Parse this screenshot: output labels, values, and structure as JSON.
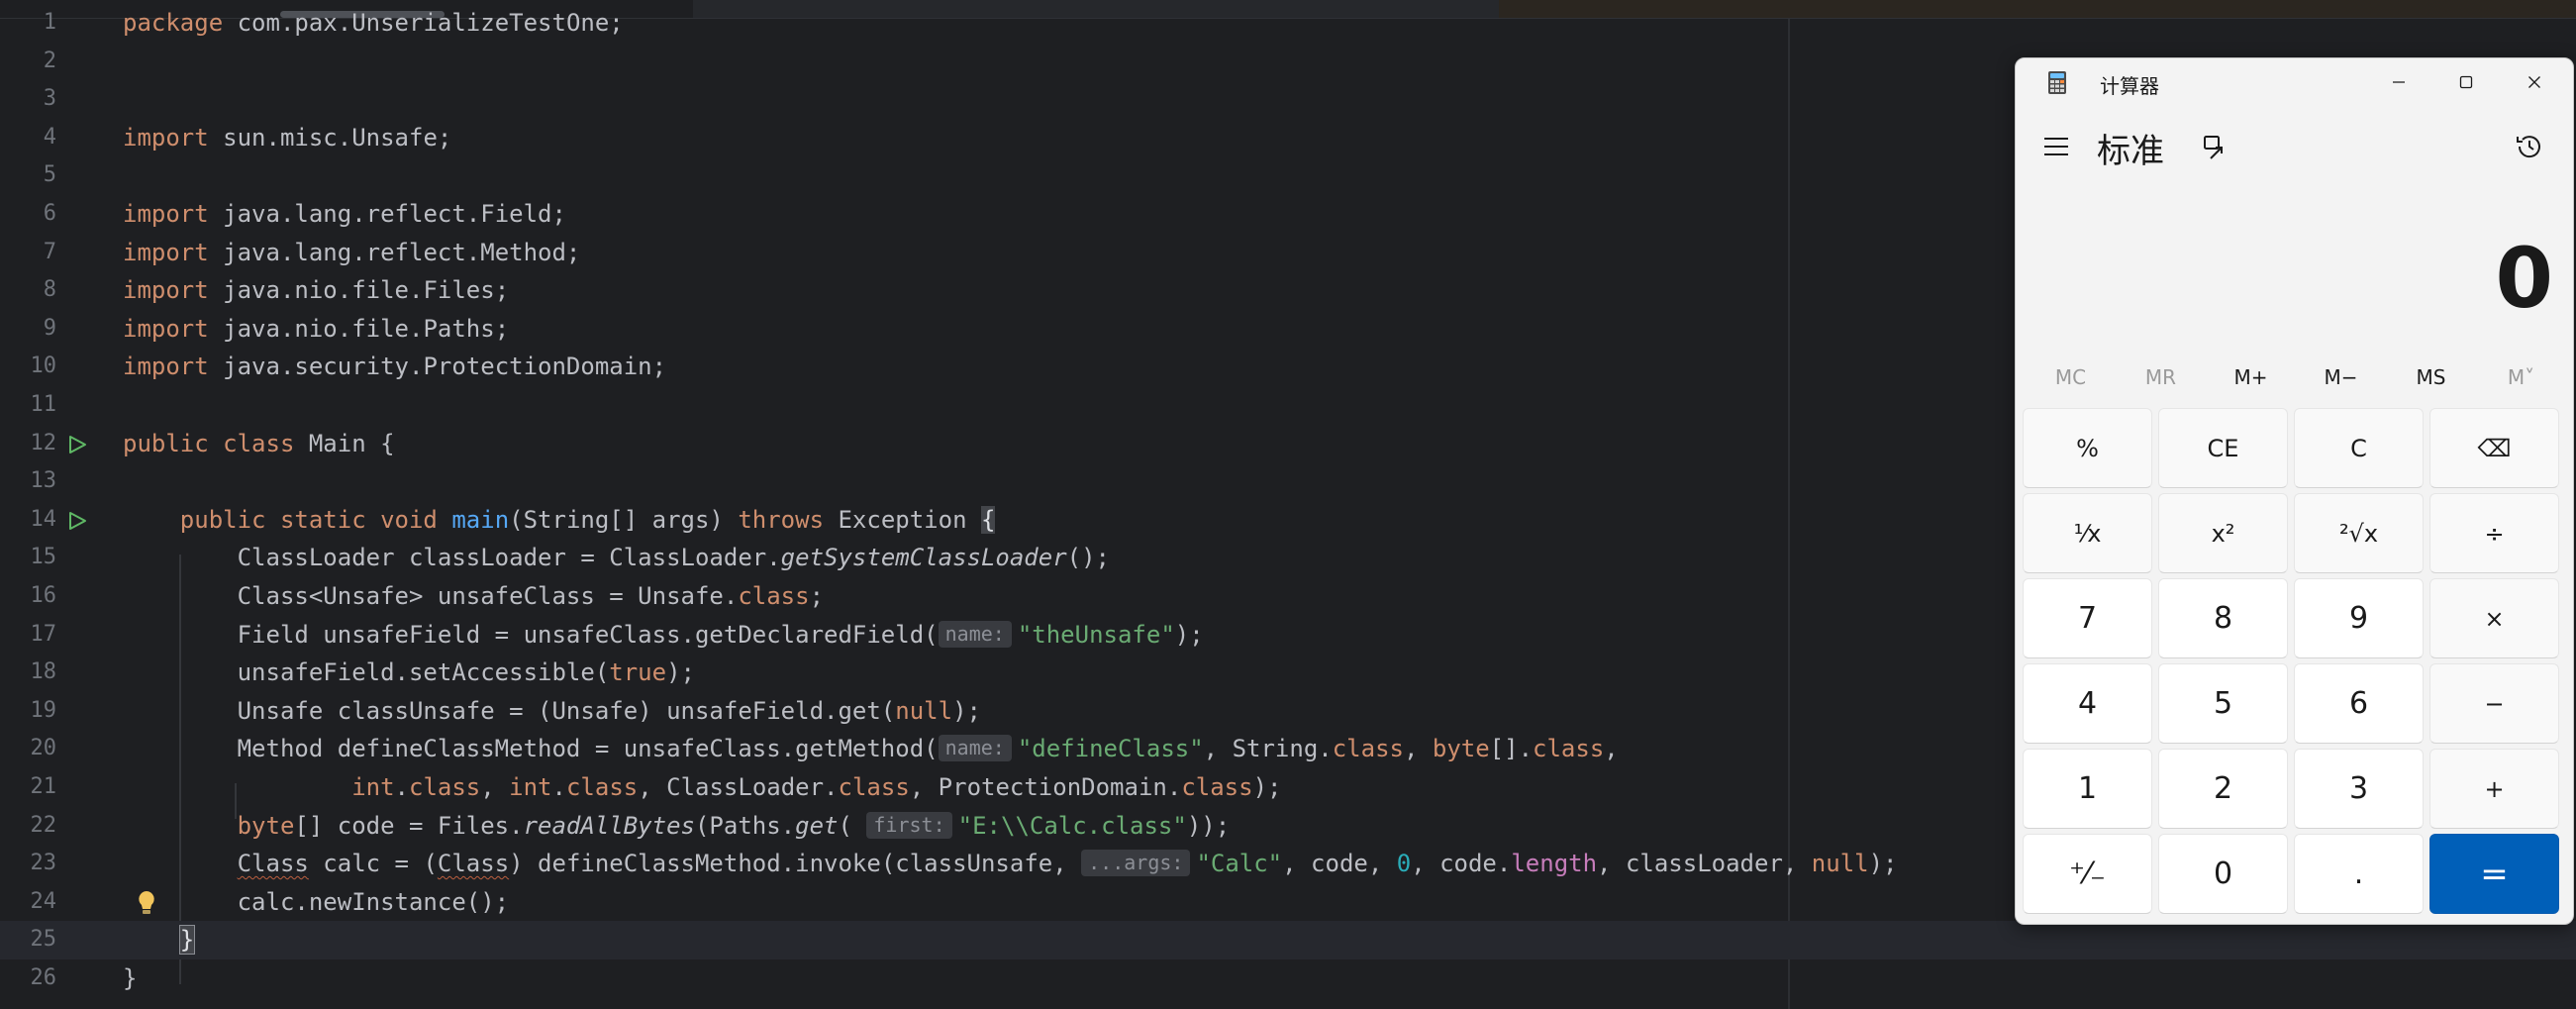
{
  "editor": {
    "current_line": 25,
    "param_hints": {
      "name": "name:",
      "first": "first:",
      "args": "...args:"
    },
    "lines": [
      {
        "n": "1",
        "parts": [
          [
            "kw",
            "package"
          ],
          [
            "t",
            " com.pax.UnserializeTestOne;"
          ]
        ]
      },
      {
        "n": "2",
        "parts": []
      },
      {
        "n": "3",
        "parts": []
      },
      {
        "n": "4",
        "parts": [
          [
            "kw",
            "import"
          ],
          [
            "t",
            " sun.misc.Unsafe;"
          ]
        ]
      },
      {
        "n": "5",
        "parts": []
      },
      {
        "n": "6",
        "parts": [
          [
            "kw",
            "import"
          ],
          [
            "t",
            " java.lang.reflect.Field;"
          ]
        ]
      },
      {
        "n": "7",
        "parts": [
          [
            "kw",
            "import"
          ],
          [
            "t",
            " java.lang.reflect.Method;"
          ]
        ]
      },
      {
        "n": "8",
        "parts": [
          [
            "kw",
            "import"
          ],
          [
            "t",
            " java.nio.file.Files;"
          ]
        ]
      },
      {
        "n": "9",
        "parts": [
          [
            "kw",
            "import"
          ],
          [
            "t",
            " java.nio.file.Paths;"
          ]
        ]
      },
      {
        "n": "10",
        "parts": [
          [
            "kw",
            "import"
          ],
          [
            "t",
            " java.security.ProtectionDomain;"
          ]
        ]
      },
      {
        "n": "11",
        "parts": []
      },
      {
        "n": "12",
        "run": true,
        "parts": [
          [
            "kw",
            "public class"
          ],
          [
            "t",
            " Main {"
          ]
        ]
      },
      {
        "n": "13",
        "parts": []
      },
      {
        "n": "14",
        "run": true,
        "parts": [
          [
            "t",
            "    "
          ],
          [
            "kw",
            "public static void"
          ],
          [
            "t",
            " "
          ],
          [
            "fn",
            "main"
          ],
          [
            "t",
            "(String[] args) "
          ],
          [
            "kw",
            "throws"
          ],
          [
            "t",
            " Exception "
          ],
          [
            "brace",
            "{"
          ]
        ]
      },
      {
        "n": "15",
        "parts": [
          [
            "t",
            "        ClassLoader classLoader = ClassLoader."
          ],
          [
            "it",
            "getSystemClassLoader"
          ],
          [
            "t",
            "();"
          ]
        ]
      },
      {
        "n": "16",
        "parts": [
          [
            "t",
            "        Class<Unsafe> unsafeClass = Unsafe."
          ],
          [
            "kw",
            "class"
          ],
          [
            "t",
            ";"
          ]
        ]
      },
      {
        "n": "17",
        "parts": [
          [
            "t",
            "        Field unsafeField = unsafeClass.getDeclaredField("
          ],
          [
            "hint",
            "name:"
          ],
          [
            "str",
            "\"theUnsafe\""
          ],
          [
            "t",
            ");"
          ]
        ]
      },
      {
        "n": "18",
        "parts": [
          [
            "t",
            "        unsafeField.setAccessible("
          ],
          [
            "kw",
            "true"
          ],
          [
            "t",
            ");"
          ]
        ]
      },
      {
        "n": "19",
        "parts": [
          [
            "t",
            "        Unsafe classUnsafe = (Unsafe) unsafeField.get("
          ],
          [
            "kw",
            "null"
          ],
          [
            "t",
            ");"
          ]
        ]
      },
      {
        "n": "20",
        "parts": [
          [
            "t",
            "        Method defineClassMethod = unsafeClass.getMethod("
          ],
          [
            "hint",
            "name:"
          ],
          [
            "str",
            "\"defineClass\""
          ],
          [
            "t",
            ", String."
          ],
          [
            "kw",
            "class"
          ],
          [
            "t",
            ", "
          ],
          [
            "kw",
            "byte"
          ],
          [
            "t",
            "[]."
          ],
          [
            "kw",
            "class"
          ],
          [
            "t",
            ","
          ]
        ]
      },
      {
        "n": "21",
        "parts": [
          [
            "t",
            "                "
          ],
          [
            "kw",
            "int"
          ],
          [
            "t",
            "."
          ],
          [
            "kw",
            "class"
          ],
          [
            "t",
            ", "
          ],
          [
            "kw",
            "int"
          ],
          [
            "t",
            "."
          ],
          [
            "kw",
            "class"
          ],
          [
            "t",
            ", ClassLoader."
          ],
          [
            "kw",
            "class"
          ],
          [
            "t",
            ", ProtectionDomain."
          ],
          [
            "kw",
            "class"
          ],
          [
            "t",
            ");"
          ]
        ]
      },
      {
        "n": "22",
        "parts": [
          [
            "t",
            "        "
          ],
          [
            "kw",
            "byte"
          ],
          [
            "t",
            "[] code = Files."
          ],
          [
            "it",
            "readAllBytes"
          ],
          [
            "t",
            "(Paths."
          ],
          [
            "it",
            "get"
          ],
          [
            "t",
            "( "
          ],
          [
            "hint",
            "first:"
          ],
          [
            "str",
            "\"E:\\\\Calc.class\""
          ],
          [
            "t",
            "));"
          ]
        ]
      },
      {
        "n": "23",
        "parts": [
          [
            "t",
            "        "
          ],
          [
            "squig",
            "Class"
          ],
          [
            "t",
            " calc = ("
          ],
          [
            "squig",
            "Class"
          ],
          [
            "t",
            ") defineClassMethod.invoke(classUnsafe, "
          ],
          [
            "hint",
            "...args:"
          ],
          [
            "str",
            "\"Calc\""
          ],
          [
            "t",
            ", code, "
          ],
          [
            "num",
            "0"
          ],
          [
            "t",
            ", code."
          ],
          [
            "fld",
            "length"
          ],
          [
            "t",
            ", classLoader, "
          ],
          [
            "kw",
            "null"
          ],
          [
            "t",
            ");"
          ]
        ]
      },
      {
        "n": "24",
        "bulb": true,
        "parts": [
          [
            "t",
            "        calc.newInstance();"
          ]
        ]
      },
      {
        "n": "25",
        "parts": [
          [
            "t",
            "    "
          ],
          [
            "bracecur",
            "}"
          ]
        ]
      },
      {
        "n": "26",
        "parts": [
          [
            "t",
            "}"
          ]
        ]
      }
    ]
  },
  "calculator": {
    "window_title": "计算器",
    "mode": "标准",
    "display": "0",
    "memory": [
      {
        "label": "MC",
        "enabled": false
      },
      {
        "label": "MR",
        "enabled": false
      },
      {
        "label": "M+",
        "enabled": true
      },
      {
        "label": "M−",
        "enabled": true
      },
      {
        "label": "MS",
        "enabled": true
      },
      {
        "label": "M˅",
        "enabled": false
      }
    ],
    "keys": [
      {
        "label": "%",
        "name": "percent-key",
        "kind": "op"
      },
      {
        "label": "CE",
        "name": "clear-entry-key",
        "kind": "op"
      },
      {
        "label": "C",
        "name": "clear-key",
        "kind": "op"
      },
      {
        "label": "⌫",
        "name": "backspace-key",
        "kind": "op"
      },
      {
        "label": "¹⁄x",
        "name": "reciprocal-key",
        "kind": "op"
      },
      {
        "label": "x²",
        "name": "square-key",
        "kind": "op"
      },
      {
        "label": "²√x",
        "name": "square-root-key",
        "kind": "op"
      },
      {
        "label": "÷",
        "name": "divide-key",
        "kind": "op"
      },
      {
        "label": "7",
        "name": "digit-7-key",
        "kind": "num"
      },
      {
        "label": "8",
        "name": "digit-8-key",
        "kind": "num"
      },
      {
        "label": "9",
        "name": "digit-9-key",
        "kind": "num"
      },
      {
        "label": "×",
        "name": "multiply-key",
        "kind": "op"
      },
      {
        "label": "4",
        "name": "digit-4-key",
        "kind": "num"
      },
      {
        "label": "5",
        "name": "digit-5-key",
        "kind": "num"
      },
      {
        "label": "6",
        "name": "digit-6-key",
        "kind": "num"
      },
      {
        "label": "−",
        "name": "subtract-key",
        "kind": "op"
      },
      {
        "label": "1",
        "name": "digit-1-key",
        "kind": "num"
      },
      {
        "label": "2",
        "name": "digit-2-key",
        "kind": "num"
      },
      {
        "label": "3",
        "name": "digit-3-key",
        "kind": "num"
      },
      {
        "label": "+",
        "name": "add-key",
        "kind": "op"
      },
      {
        "label": "⁺⁄₋",
        "name": "negate-key",
        "kind": "num"
      },
      {
        "label": "0",
        "name": "digit-0-key",
        "kind": "num"
      },
      {
        "label": ".",
        "name": "decimal-key",
        "kind": "num"
      },
      {
        "label": "=",
        "name": "equals-key",
        "kind": "equals"
      }
    ],
    "colors": {
      "accent": "#005fb8",
      "background": "#f3f3f3"
    }
  }
}
